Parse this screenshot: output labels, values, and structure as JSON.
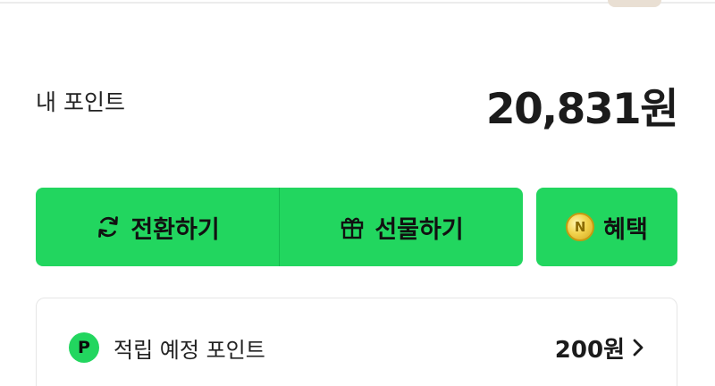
{
  "points": {
    "label": "내 포인트",
    "value": "20,831원"
  },
  "actions": {
    "convert_label": "전환하기",
    "gift_label": "선물하기",
    "benefit_label": "혜택",
    "coin_icon_text": "N"
  },
  "expected": {
    "badge": "P",
    "label": "적립 예정 포인트",
    "value": "200원"
  },
  "colors": {
    "accent": "#22d65f",
    "text": "#1b1b1b",
    "card_border": "#e6e6e6"
  },
  "icons": {
    "convert": "refresh-icon",
    "gift": "gift-icon",
    "benefit": "coin-icon",
    "chevron": "chevron-right-icon"
  }
}
